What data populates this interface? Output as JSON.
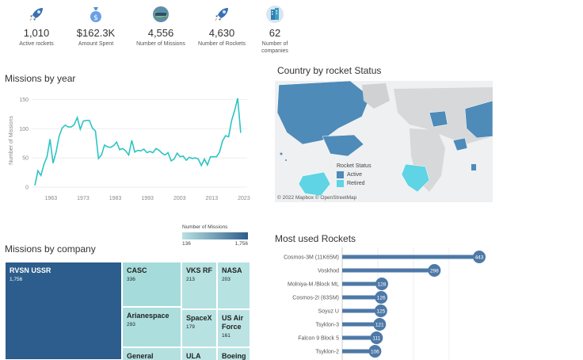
{
  "kpis": [
    {
      "icon": "rocket-icon",
      "value": "1,010",
      "label": "Active rockets"
    },
    {
      "icon": "money-bag-icon",
      "value": "$162.3K",
      "label": "Amount Spent"
    },
    {
      "icon": "globe-travel-icon",
      "value": "4,556",
      "label": "Number of Missions"
    },
    {
      "icon": "rocket-icon",
      "value": "4,630",
      "label": "Number of Rockets"
    },
    {
      "icon": "building-icon",
      "value": "62",
      "label": "Number of companies"
    }
  ],
  "missions_by_year": {
    "title": "Missions by year",
    "ylabel": "Number of Missions",
    "yticks": [
      "0",
      "50",
      "100",
      "150"
    ],
    "xticks": [
      "1963",
      "1973",
      "1983",
      "1993",
      "2003",
      "2013",
      "2023"
    ],
    "line_color": "#2ec4c4"
  },
  "country_map": {
    "title": "Country by rocket Status",
    "legend_title": "Rocket Status",
    "legend": [
      {
        "label": "Active",
        "color": "#4e8bb8"
      },
      {
        "label": "Retired",
        "color": "#5ed4e4"
      }
    ],
    "credit": "© 2022 Mapbox © OpenStreetMap"
  },
  "missions_by_company": {
    "title": "Missions by company",
    "color_legend_title": "Number of Missions",
    "color_legend_min": "136",
    "color_legend_max": "1,756",
    "cells": [
      {
        "name": "RVSN USSR",
        "value": "1,756"
      },
      {
        "name": "CASC",
        "value": "336"
      },
      {
        "name": "VKS RF",
        "value": "213"
      },
      {
        "name": "NASA",
        "value": "203"
      },
      {
        "name": "Arianespace",
        "value": "293"
      },
      {
        "name": "SpaceX",
        "value": "179"
      },
      {
        "name": "US Air Force",
        "value": "161"
      },
      {
        "name": "General",
        "value": ""
      },
      {
        "name": "ULA",
        "value": ""
      },
      {
        "name": "Boeing",
        "value": ""
      }
    ]
  },
  "most_used_rockets": {
    "title": "Most used Rockets",
    "bar_color": "#4e79a7"
  },
  "chart_data": [
    {
      "type": "line",
      "title": "Missions by year",
      "xlabel": "",
      "ylabel": "Number of Missions",
      "x": [
        1957,
        1958,
        1959,
        1960,
        1961,
        1962,
        1963,
        1964,
        1965,
        1966,
        1967,
        1968,
        1969,
        1970,
        1971,
        1972,
        1973,
        1974,
        1975,
        1976,
        1977,
        1978,
        1979,
        1980,
        1981,
        1982,
        1983,
        1984,
        1985,
        1986,
        1987,
        1988,
        1989,
        1990,
        1991,
        1992,
        1993,
        1994,
        1995,
        1996,
        1997,
        1998,
        1999,
        2000,
        2001,
        2002,
        2003,
        2004,
        2005,
        2006,
        2007,
        2008,
        2009,
        2010,
        2011,
        2012,
        2013,
        2014,
        2015,
        2016,
        2017,
        2018,
        2019,
        2020,
        2021,
        2022
      ],
      "series": [
        {
          "values": [
            3,
            28,
            20,
            39,
            52,
            82,
            41,
            60,
            87,
            101,
            106,
            103,
            103,
            107,
            119,
            99,
            113,
            114,
            114,
            101,
            96,
            49,
            55,
            72,
            69,
            68,
            71,
            77,
            64,
            66,
            62,
            55,
            80,
            60,
            63,
            62,
            65,
            59,
            61,
            59,
            66,
            63,
            58,
            55,
            59,
            45,
            48,
            58,
            52,
            53,
            46,
            51,
            49,
            50,
            48,
            37,
            48,
            38,
            52,
            52,
            52,
            60,
            79,
            88,
            86,
            114,
            131,
            152,
            93
          ]
        }
      ],
      "ylim": [
        0,
        160
      ],
      "xticks": [
        1963,
        1973,
        1983,
        1993,
        2003,
        2013,
        2023
      ]
    },
    {
      "type": "bar",
      "title": "Most used Rockets",
      "categories": [
        "Cosmos-3M (11K65M)",
        "Voskhod",
        "Molniya-M /Block ML",
        "Cosmos-2I (63SM)",
        "Soyuz U",
        "Tsyklon-3",
        "Falcon 9 Block 5",
        "Tsyklon-2"
      ],
      "values": [
        443,
        298,
        128,
        126,
        125,
        121,
        111,
        106
      ],
      "orientation": "horizontal"
    },
    {
      "type": "table",
      "title": "Missions by company",
      "categories": [
        "RVSN USSR",
        "CASC",
        "VKS RF",
        "NASA",
        "Arianespace",
        "SpaceX",
        "US Air Force"
      ],
      "values": [
        1756,
        336,
        213,
        203,
        293,
        179,
        161
      ]
    }
  ]
}
